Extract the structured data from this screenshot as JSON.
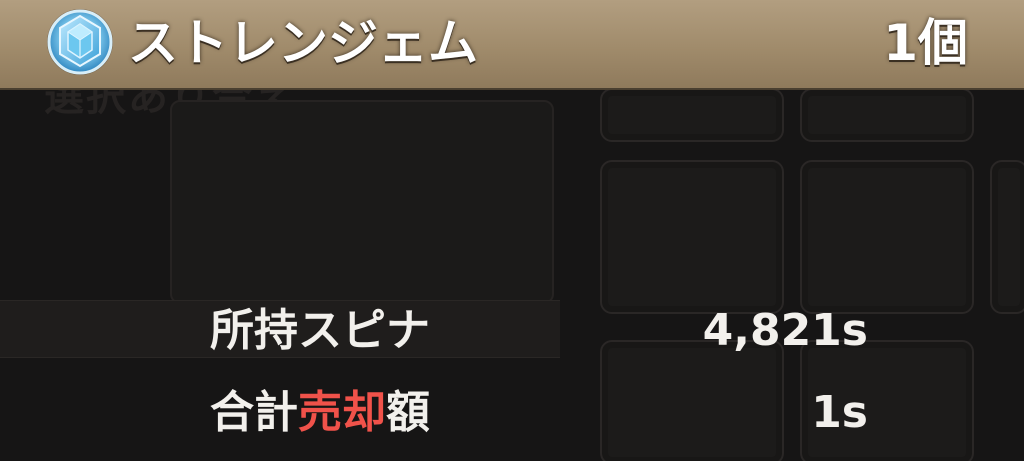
{
  "header": {
    "item_name": "ストレンジェム",
    "item_count": "1個",
    "gem_icon": "blue-gem-icon"
  },
  "info": {
    "owned_label": "所持スピナ",
    "owned_value": "4,821s",
    "total_label_before": "合計",
    "total_label_accent": "売却",
    "total_label_after": "額",
    "total_value": "1s"
  },
  "background": {
    "ghost_text": "選択あり合え"
  },
  "colors": {
    "header_bar": "#a08b6b",
    "accent": "#f0524a",
    "text": "#f2f0ec",
    "gem": "#5fc3ec"
  }
}
